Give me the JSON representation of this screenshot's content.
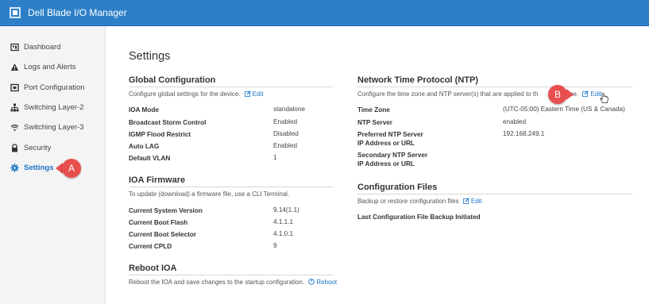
{
  "app": {
    "title": "Dell Blade I/O Manager"
  },
  "sidebar": {
    "items": [
      {
        "label": "Dashboard",
        "icon": "dashboard-icon"
      },
      {
        "label": "Logs and Alerts",
        "icon": "alert-icon"
      },
      {
        "label": "Port Configuration",
        "icon": "port-icon"
      },
      {
        "label": "Switching Layer-2",
        "icon": "network-icon"
      },
      {
        "label": "Switching Layer-3",
        "icon": "wifi-icon"
      },
      {
        "label": "Security",
        "icon": "lock-icon"
      },
      {
        "label": "Settings",
        "icon": "gear-icon",
        "active": true
      }
    ]
  },
  "callouts": {
    "a": "A",
    "b": "B"
  },
  "page": {
    "title": "Settings"
  },
  "global_config": {
    "title": "Global Configuration",
    "description": "Configure global settings for the device.",
    "edit_label": "Edit",
    "rows": [
      {
        "label": "IOA Mode",
        "value": "standalone"
      },
      {
        "label": "Broadcast Storm Control",
        "value": "Enabled"
      },
      {
        "label": "IGMP Flood Restrict",
        "value": "Disabled"
      },
      {
        "label": "Auto LAG",
        "value": "Enabled"
      },
      {
        "label": "Default VLAN",
        "value": "1"
      }
    ]
  },
  "firmware": {
    "title": "IOA Firmware",
    "description": "To update (download) a firmware file, use a CLI Terminal.",
    "rows": [
      {
        "label": "Current System Version",
        "value": "9.14(1.1)"
      },
      {
        "label": "Current Boot Flash",
        "value": "4.1.1.1"
      },
      {
        "label": "Current Boot Selector",
        "value": "4.1.0.1"
      },
      {
        "label": "Current CPLD",
        "value": "9"
      }
    ]
  },
  "reboot": {
    "title": "Reboot IOA",
    "description": "Reboot the IOA and save changes to the startup configuration.",
    "link_label": "Reboot"
  },
  "ntp": {
    "title": "Network Time Protocol (NTP)",
    "description_before": "Configure the time zone and NTP server(s) that are applied to th",
    "description_after": "ce.",
    "edit_label": "Edit",
    "rows": [
      {
        "label": "Time Zone",
        "value": "(UTC-05:00) Eastern Time (US & Canada)"
      },
      {
        "label": "NTP Server",
        "value": "enabled"
      },
      {
        "label": "Preferred NTP Server\nIP Address or URL",
        "value": "192.168.249.1"
      },
      {
        "label": "Secondary NTP Server\nIP Address or URL",
        "value": ""
      }
    ]
  },
  "config_files": {
    "title": "Configuration Files",
    "description": "Backup or restore configuration files",
    "edit_label": "Edit",
    "rows": [
      {
        "label": "Last Configuration File Backup Initiated",
        "value": ""
      }
    ]
  },
  "colors": {
    "topbar": "#2d80c8",
    "accent": "#1b75c9",
    "callout": "#e84e4e"
  }
}
